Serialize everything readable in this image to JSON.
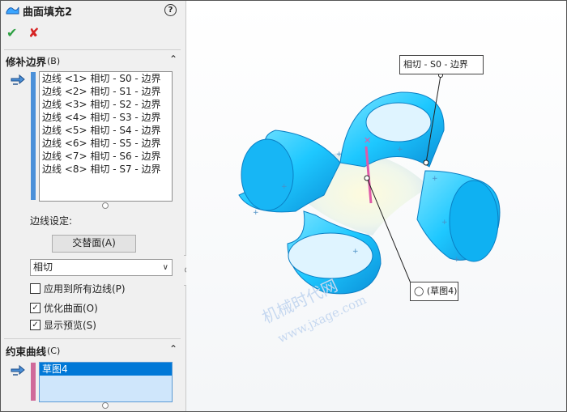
{
  "panel": {
    "title": "曲面填充2",
    "help_label": "?",
    "ok_glyph": "✔",
    "cancel_glyph": "✘",
    "patch_boundary": {
      "header": "修补边界",
      "shortcut": "(B)",
      "items": [
        "边线 <1> 相切 - S0 - 边界",
        "边线 <2> 相切 - S1 - 边界",
        "边线 <3> 相切 - S2 - 边界",
        "边线 <4> 相切 - S3 - 边界",
        "边线 <5> 相切 - S4 - 边界",
        "边线 <6> 相切 - S5 - 边界",
        "边线 <7> 相切 - S6 - 边界",
        "边线 <8> 相切 - S7 - 边界"
      ],
      "edge_settings_label": "边线设定:",
      "alternate_face_button": "交替面(A)",
      "condition_select": "相切",
      "apply_all_edges": {
        "label": "应用到所有边线(P)",
        "checked": false
      },
      "optimize_surface": {
        "label": "优化曲面(O)",
        "checked": true
      },
      "show_preview": {
        "label": "显示预览(S)",
        "checked": true
      }
    },
    "constraint_curves": {
      "header": "约束曲线",
      "shortcut": "(C)",
      "items": [
        "草图4"
      ]
    }
  },
  "viewport": {
    "callout_top": "相切 - S0 - 边界",
    "callout_bottom": "(草图4)",
    "watermark_cn": "机械时代网",
    "watermark_url": "www.jxage.com"
  },
  "colors": {
    "panel_bg": "#f0f0f0",
    "surface_cyan": "#1ec8ff",
    "surface_dark": "#0a8fd8",
    "selection_blue": "#0078d7",
    "edge_color_bar": "#4a90d9",
    "curve_color_bar": "#d06a9a",
    "constraint_curve": "#e05aa8",
    "ok_green": "#2ea043",
    "cancel_red": "#d62424"
  }
}
